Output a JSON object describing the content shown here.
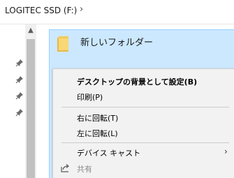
{
  "address": {
    "path": "LOGITEC SSD (F:)",
    "separator": "›"
  },
  "nav": {
    "pinned_icons": [
      "pin-icon",
      "pin-icon",
      "pin-icon",
      "pin-icon"
    ],
    "scroll_up": "▲"
  },
  "folder": {
    "name": "新しいフォルダー",
    "icon": "folder-icon"
  },
  "context_menu": {
    "items": [
      {
        "label": "デスクトップの背景として設定(B)",
        "bold": true
      },
      {
        "label": "印刷(P)"
      },
      {
        "label": "右に回転(T)"
      },
      {
        "label": "左に回転(L)"
      },
      {
        "label": "デバイス キャスト",
        "submenu_arrow": "›"
      },
      {
        "label": "共有",
        "disabled": true,
        "icon": "share-icon"
      }
    ]
  },
  "colors": {
    "selection": "#cce8ff",
    "selection_border": "#99d1ff",
    "menu_bg": "#f2f2f2",
    "folder_yellow": "#f8d775"
  }
}
